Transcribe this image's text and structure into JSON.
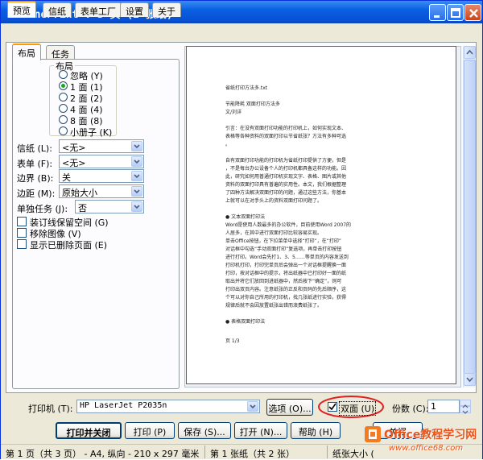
{
  "window": {
    "title": "FinePrint : 3 页 (2 张纸)",
    "minimize": "minimize",
    "maximize": "maximize",
    "close": "close"
  },
  "tabs": [
    "预览",
    "信纸",
    "表单工厂",
    "设置",
    "关于"
  ],
  "subtabs": [
    "布局",
    "任务"
  ],
  "layout_group": {
    "title": "布局",
    "options": [
      "忽略 (Y)",
      "1 面 (1)",
      "2 面 (2)",
      "4 面 (4)",
      "8 面 (8)",
      "小册子 (K)"
    ],
    "selected": "1 面 (1)"
  },
  "fields": [
    {
      "label": "信纸 (L):",
      "value": "<无>"
    },
    {
      "label": "表单 (F):",
      "value": "<无>"
    },
    {
      "label": "边界 (B):",
      "value": "关"
    },
    {
      "label": "边距 (M):",
      "value": "原始大小"
    },
    {
      "label": "单独任务 (J):",
      "value": "否"
    }
  ],
  "checkboxes": [
    {
      "label": "装订线保留空间 (G)",
      "checked": false
    },
    {
      "label": "移除图像 (V)",
      "checked": false
    },
    {
      "label": "显示已删除页面 (E)",
      "checked": false
    }
  ],
  "preview_page": {
    "lines": [
      "省纸打印方法多.txt",
      "节能降耗  双面打印方法多",
      "文/刘详",
      "引言：在没有双面打印功能的打印机上，如何实现文本、",
      "表格等各种资料的双面打印以节省纸张？方法有多种可选",
      "。",
      "自有双面打印功能的打印机为省纸打印提供了方便，但是",
      "，不是每台办公设备个人的打印机都具备这样的功能。因",
      "此，研究如何用普通打印机实现文字、表格、图片或其他",
      "资料的双面打印具有普遍的实用性。本文，我们根据整理",
      "了四种方法解决双面打印的问题，通过这些方法，你基本",
      "上就可以在对手头上的资料双面打印问题了。",
      "● 文本双面打印法",
      "Word是使用人数最多的办公软件，目前使用Word 2007的",
      "人居多，在其中进行双面打印比较容易实现。",
      "单击Office按钮，在下拉菜单中选择“打印”，在“打印”",
      "对话框中勾选“手动双面打印”复选项，再单击打印按钮",
      "进行打印。Word会先打1、3、5……等单页的内容发送到",
      "打印机打印，打印完单页后会弹出一个对话框提醒换一面",
      "打印，按对话框中的提示，将出纸器中已打印好一面的纸",
      "取出并将它们放回到进纸器中，然后按下“确定”，则可",
      "打印出双页内容。注意纸张的正反和页码的先后顺序，这",
      "个可以对你自己所用的打印机，找几张纸进行实验，获得",
      "规律后就不会因放置纸张出错而浪费纸张了。",
      "● 表格双面打印法",
      "页 1/3"
    ]
  },
  "printer": {
    "label": "打印机 (T):",
    "value": "HP LaserJet P2035n"
  },
  "options_button": "选项 (O)...",
  "duplex": {
    "label": "双面 (U)",
    "checked": true
  },
  "copies": {
    "label": "份数 (C):",
    "value": "1"
  },
  "actions": [
    "打印并关闭",
    "打印 (P)",
    "保存 (S)...",
    "打开 (N)...",
    "帮助 (H)",
    "关闭"
  ],
  "statusbar": [
    "第 1 页（共 3 页） - A4, 纵向 - 210 x 297 毫米",
    "第 1 张纸（共 2 张）",
    "纸张大小 ("
  ],
  "watermark": {
    "brand": "Office教程学习网",
    "url": "www.office68.com"
  }
}
